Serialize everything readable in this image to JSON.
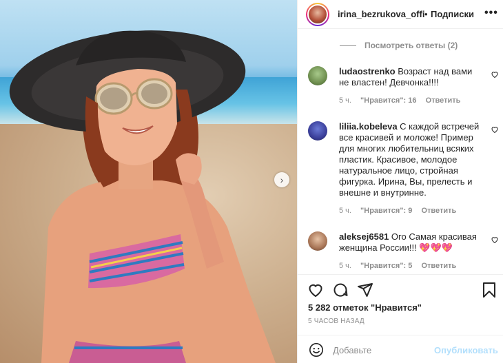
{
  "post": {
    "username": "irina_bezrukova_offi",
    "separator": "•",
    "follow_label": "Подписки",
    "more_label": "•••"
  },
  "view_replies": "Посмотреть ответы (2)",
  "comments": [
    {
      "user": "ludaostrenko",
      "text": "Возраст над вами не властен! Девчонка!!!!",
      "time": "5 ч.",
      "likes": "\"Нравится\": 16",
      "reply": "Ответить"
    },
    {
      "user": "liliia.kobeleva",
      "text": "С каждой встречей все красивей и моложе! Пример для многих любительниц всяких пластик. Красивое, молодое натуральное лицо, стройная фигурка. Ирина, Вы, прелесть и внешне и внутринне.",
      "time": "5 ч.",
      "likes": "\"Нравится\": 9",
      "reply": "Ответить"
    },
    {
      "user": "aleksej6581",
      "text": "Ого Самая красивая женщина России!!! 💖💖💖",
      "time": "5 ч.",
      "likes": "\"Нравится\": 5",
      "reply": "Ответить"
    }
  ],
  "likes_count": "5 282 отметок \"Нравится\"",
  "posted_ago": "5 ЧАСОВ НАЗАД",
  "add_comment": {
    "placeholder": "Добавьте",
    "publish_label": "Опубликовать"
  },
  "colors": {
    "accent_disabled": "#b2dffc",
    "muted_text": "#8e8e8e",
    "primary_text": "#262626"
  },
  "icons": [
    "more-icon",
    "heart-icon",
    "comment-icon",
    "share-icon",
    "bookmark-icon",
    "emoji-icon",
    "next-arrow-icon"
  ]
}
